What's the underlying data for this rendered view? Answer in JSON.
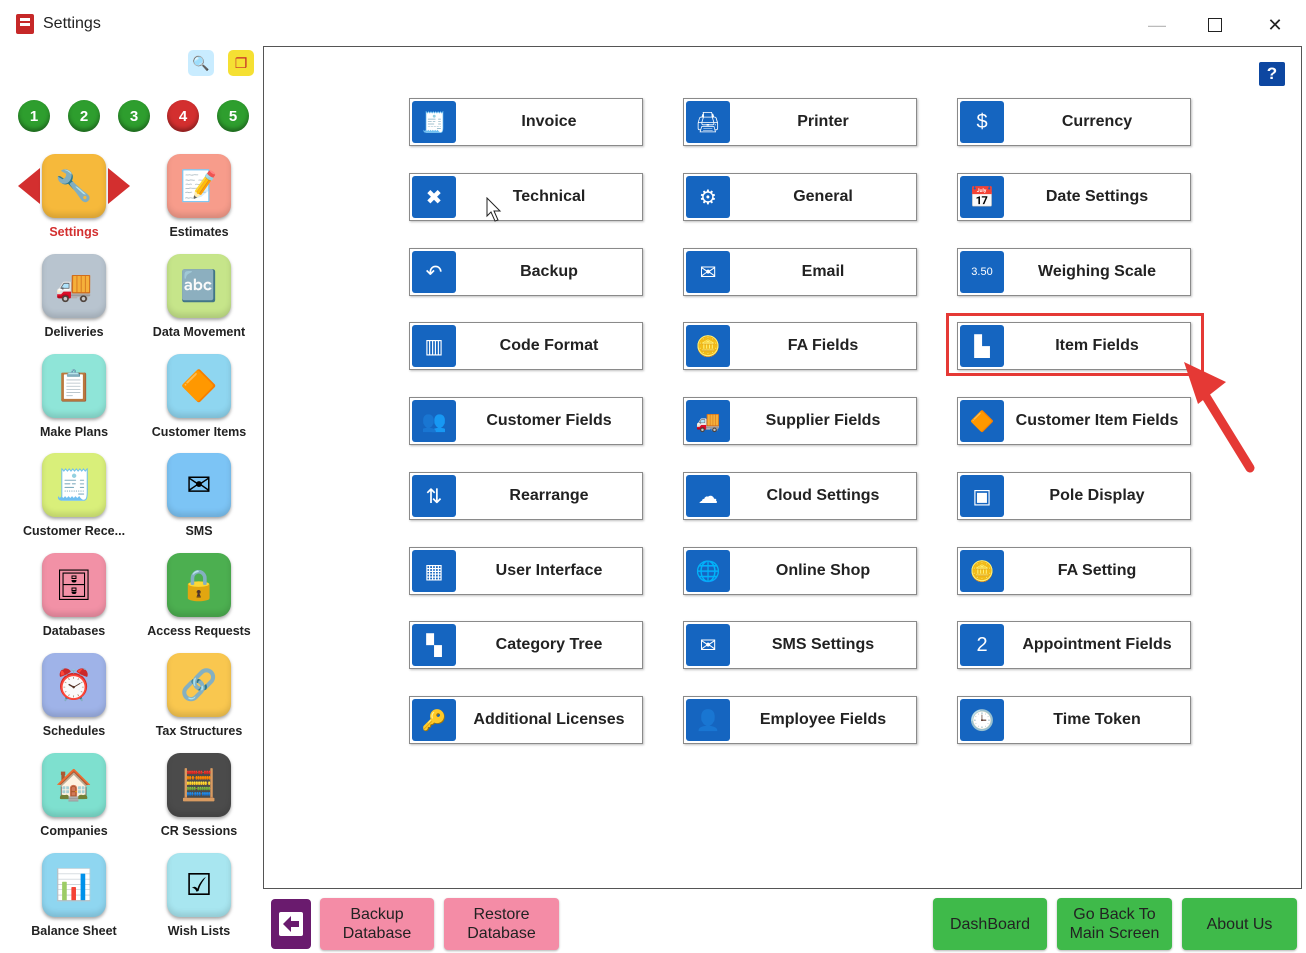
{
  "window": {
    "title": "Settings",
    "minimize_glyph": "—",
    "close_glyph": "✕"
  },
  "toolbar": {
    "search_icon": "magnifier-icon",
    "screens_icon": "windows-icon"
  },
  "pages": [
    "1",
    "2",
    "3",
    "4",
    "5"
  ],
  "active_page": "4",
  "sidebar": {
    "items": [
      {
        "label": "Settings",
        "icon": "tools-icon",
        "glyph": "🔧",
        "bg": "#f6b93b"
      },
      {
        "label": "Estimates",
        "icon": "estimate-list-icon",
        "glyph": "📝",
        "bg": "#f79c8b"
      },
      {
        "label": "Deliveries",
        "icon": "delivery-truck-icon",
        "glyph": "🚚",
        "bg": "#b8c4cf"
      },
      {
        "label": "Data Movement",
        "icon": "data-movement-icon",
        "glyph": "🔤",
        "bg": "#c6e58a"
      },
      {
        "label": "Make Plans",
        "icon": "plan-clipboard-icon",
        "glyph": "📋",
        "bg": "#8fe5d8"
      },
      {
        "label": "Customer Items",
        "icon": "shapes-icon",
        "glyph": "🔶",
        "bg": "#8fd6f0"
      },
      {
        "label": "Customer Rece...",
        "icon": "receipt-icon",
        "glyph": "🧾",
        "bg": "#d9ef7a"
      },
      {
        "label": "SMS",
        "icon": "sms-folder-icon",
        "glyph": "✉",
        "bg": "#7cc4f5"
      },
      {
        "label": "Databases",
        "icon": "database-icon",
        "glyph": "🗄",
        "bg": "#f291a6"
      },
      {
        "label": "Access Requests",
        "icon": "access-lock-icon",
        "glyph": "🔒",
        "bg": "#4caf50"
      },
      {
        "label": "Schedules",
        "icon": "alarm-clock-icon",
        "glyph": "⏰",
        "bg": "#9fb3e8"
      },
      {
        "label": "Tax Structures",
        "icon": "tax-structure-icon",
        "glyph": "🔗",
        "bg": "#f9c74f"
      },
      {
        "label": "Companies",
        "icon": "house-icon",
        "glyph": "🏠",
        "bg": "#7ee0cf"
      },
      {
        "label": "CR Sessions",
        "icon": "cash-register-icon",
        "glyph": "🧮",
        "bg": "#4b4b4b"
      },
      {
        "label": "Balance Sheet",
        "icon": "bar-chart-icon",
        "glyph": "📊",
        "bg": "#8fd6f0"
      },
      {
        "label": "Wish Lists",
        "icon": "checklist-icon",
        "glyph": "☑",
        "bg": "#a8e6f0"
      }
    ]
  },
  "settings_buttons": [
    {
      "label": "Invoice",
      "icon": "invoice-icon",
      "glyph": "🧾"
    },
    {
      "label": "Printer",
      "icon": "printer-icon",
      "glyph": "🖨"
    },
    {
      "label": "Currency",
      "icon": "currency-icon",
      "glyph": "$"
    },
    {
      "label": "Technical",
      "icon": "wrench-screwdriver-icon",
      "glyph": "✖"
    },
    {
      "label": "General",
      "icon": "gear-icon",
      "glyph": "⚙"
    },
    {
      "label": "Date Settings",
      "icon": "calendar-clock-icon",
      "glyph": "📅"
    },
    {
      "label": "Backup",
      "icon": "backup-arrow-icon",
      "glyph": "↶"
    },
    {
      "label": "Email",
      "icon": "envelope-icon",
      "glyph": "✉"
    },
    {
      "label": "Weighing Scale",
      "icon": "scale-display-icon",
      "glyph": "3.50"
    },
    {
      "label": "Code Format",
      "icon": "barcode-icon",
      "glyph": "▥"
    },
    {
      "label": "FA Fields",
      "icon": "coins-icon",
      "glyph": "🪙"
    },
    {
      "label": "Item Fields",
      "icon": "item-fields-icon",
      "glyph": "▙"
    },
    {
      "label": "Customer Fields",
      "icon": "users-icon",
      "glyph": "👥"
    },
    {
      "label": "Supplier Fields",
      "icon": "supplier-truck-icon",
      "glyph": "🚚"
    },
    {
      "label": "Customer Item Fields",
      "icon": "customer-item-icon",
      "glyph": "🔶"
    },
    {
      "label": "Rearrange",
      "icon": "rearrange-icon",
      "glyph": "⇅"
    },
    {
      "label": "Cloud Settings",
      "icon": "cloud-icon",
      "glyph": "☁"
    },
    {
      "label": "Pole Display",
      "icon": "pole-display-icon",
      "glyph": "▣"
    },
    {
      "label": "User Interface",
      "icon": "grid-icon",
      "glyph": "▦"
    },
    {
      "label": "Online Shop",
      "icon": "globe-icon",
      "glyph": "🌐"
    },
    {
      "label": "FA Setting",
      "icon": "coins-settings-icon",
      "glyph": "🪙"
    },
    {
      "label": "Category Tree",
      "icon": "tree-icon",
      "glyph": "▚"
    },
    {
      "label": "SMS Settings",
      "icon": "sms-settings-icon",
      "glyph": "✉"
    },
    {
      "label": "Appointment Fields",
      "icon": "appointment-calendar-icon",
      "glyph": "2"
    },
    {
      "label": "Additional Licenses",
      "icon": "key-icon",
      "glyph": "🔑"
    },
    {
      "label": "Employee Fields",
      "icon": "employee-icon",
      "glyph": "👤"
    },
    {
      "label": "Time Token",
      "icon": "clock-icon",
      "glyph": "🕒"
    }
  ],
  "highlighted_button": "Item Fields",
  "help_label": "?",
  "bottom": {
    "backup_database": "Backup\nDatabase",
    "restore_database": "Restore\nDatabase",
    "dashboard": "DashBoard",
    "go_back": "Go Back To\nMain Screen",
    "about_us": "About Us"
  },
  "colors": {
    "accent_blue": "#1565c0",
    "highlight_red": "#e53935",
    "bottom_pink": "#f48ca6",
    "bottom_green": "#3fba4a",
    "back_purple": "#6a1b6e"
  }
}
